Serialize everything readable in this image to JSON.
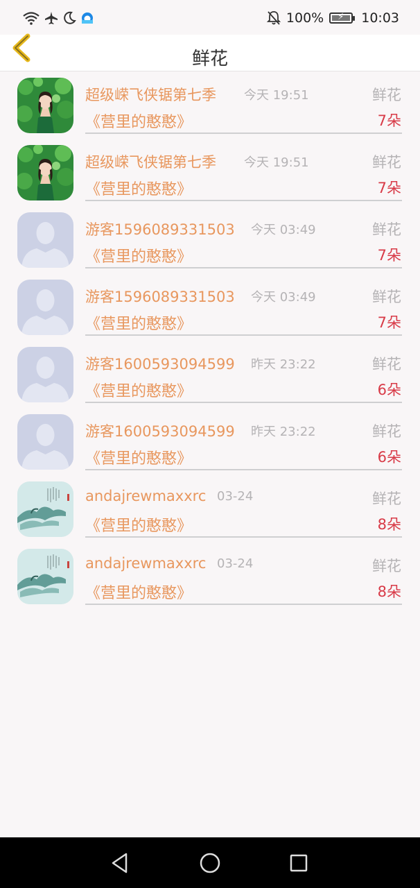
{
  "status_bar": {
    "battery": "100%",
    "time": "10:03",
    "icons": [
      "wifi-icon",
      "airplane-icon",
      "moon-icon",
      "browser-icon",
      "mute-icon",
      "battery-icon"
    ]
  },
  "header": {
    "title": "鲜花",
    "back_icon": "chevron-left-icon",
    "accent_color": "#e7b91c"
  },
  "gifts": [
    {
      "avatar": "girl-photo",
      "name": "超级嵘飞侠锯第七季",
      "time": "今天 19:51",
      "type": "鲜花",
      "book": "《营里的憨憨》",
      "count": "7朵"
    },
    {
      "avatar": "girl-photo",
      "name": "超级嵘飞侠锯第七季",
      "time": "今天 19:51",
      "type": "鲜花",
      "book": "《营里的憨憨》",
      "count": "7朵"
    },
    {
      "avatar": "default-avatar",
      "name": "游客1596089331503",
      "time": "今天 03:49",
      "type": "鲜花",
      "book": "《营里的憨憨》",
      "count": "7朵"
    },
    {
      "avatar": "default-avatar",
      "name": "游客1596089331503",
      "time": "今天 03:49",
      "type": "鲜花",
      "book": "《营里的憨憨》",
      "count": "7朵"
    },
    {
      "avatar": "default-avatar",
      "name": "游客1600593094599",
      "time": "昨天 23:22",
      "type": "鲜花",
      "book": "《营里的憨憨》",
      "count": "6朵"
    },
    {
      "avatar": "default-avatar",
      "name": "游客1600593094599",
      "time": "昨天 23:22",
      "type": "鲜花",
      "book": "《营里的憨憨》",
      "count": "6朵"
    },
    {
      "avatar": "ink-painting",
      "name": "andajrewmaxxrc",
      "time": "03-24",
      "type": "鲜花",
      "book": "《营里的憨憨》",
      "count": "8朵"
    },
    {
      "avatar": "ink-painting",
      "name": "andajrewmaxxrc",
      "time": "03-24",
      "type": "鲜花",
      "book": "《营里的憨憨》",
      "count": "8朵"
    }
  ],
  "colors": {
    "name": "#e8975e",
    "meta": "#b5b3b5",
    "count": "#d83a47",
    "background": "#f9f6f7"
  },
  "nav": [
    "back-triangle-icon",
    "home-circle-icon",
    "recents-square-icon"
  ]
}
